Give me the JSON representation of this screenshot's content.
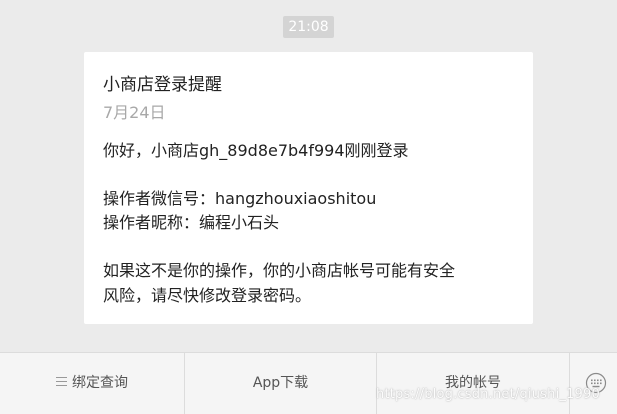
{
  "chat": {
    "timestamp": "21:08"
  },
  "message": {
    "title": "小商店登录提醒",
    "date": "7月24日",
    "greeting": "你好，小商店gh_89d8e7b4f994刚刚登录",
    "operator_wechat": "操作者微信号：hangzhouxiaoshitou",
    "operator_nickname": "操作者昵称：编程小石头",
    "warning_line1": "如果这不是你的操作，你的小商店帐号可能有安全",
    "warning_line2": "风险，请尽快修改登录密码。"
  },
  "menu": {
    "item1": "绑定查询",
    "item2": "App下载",
    "item3": "我的帐号",
    "keyboard_icon": "keyboard-icon",
    "menu_icon": "menu-lines-icon"
  },
  "watermark": "https://blog.csdn.net/qiushi_1990"
}
